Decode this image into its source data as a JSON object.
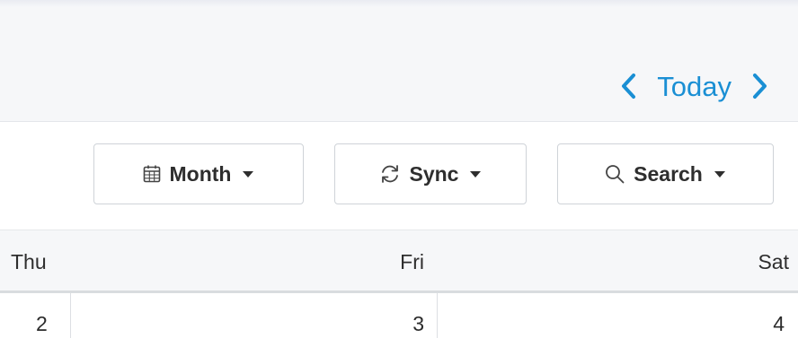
{
  "navigation": {
    "prev_icon": "chevron-left-icon",
    "today_label": "Today",
    "next_icon": "chevron-right-icon",
    "accent_color": "#1a8fd4"
  },
  "toolbar": {
    "month_label": "Month",
    "month_icon": "calendar-icon",
    "sync_label": "Sync",
    "sync_icon": "sync-icon",
    "search_label": "Search",
    "search_icon": "search-icon",
    "caret_icon": "caret-down-icon"
  },
  "calendar": {
    "day_headers": [
      "Thu",
      "Fri",
      "Sat"
    ],
    "dates": [
      "2",
      "3",
      "4"
    ]
  }
}
